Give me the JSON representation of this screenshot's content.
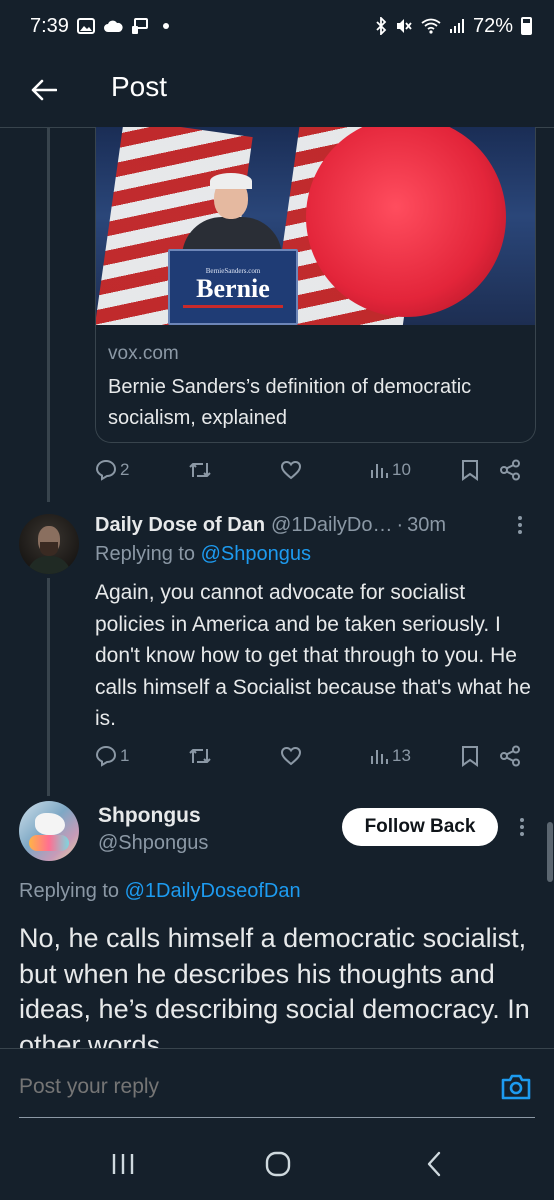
{
  "status_bar": {
    "time": "7:39",
    "battery": "72%"
  },
  "header": {
    "title": "Post"
  },
  "link_card": {
    "podium_sub": "BernieSanders.com",
    "podium_main": "Bernie",
    "domain": "vox.com",
    "title": "Bernie Sanders’s definition of democratic socialism, explained"
  },
  "original_actions": {
    "replies": "2",
    "reposts": "",
    "likes": "",
    "views": "10"
  },
  "reply_tweet": {
    "name": "Daily Dose of Dan",
    "handle": "@1DailyDo…",
    "dot": "·",
    "time": "30m",
    "replying_label": "Replying to",
    "replying_handle": "@Shpongus",
    "body": "Again, you cannot advocate for socialist policies in America and be taken seriously. I don't know how to get that through to you. He calls himself a Socialist because that's what he is.",
    "replies": "1",
    "views": "13"
  },
  "main_tweet": {
    "name": "Shpongus",
    "handle": "@Shpongus",
    "follow_label": "Follow Back",
    "replying_label": "Replying to",
    "replying_handle": "@1DailyDoseofDan",
    "body": "No, he calls himself a democratic socialist, but when he describes his thoughts and ideas, he’s describing social democracy. In other words"
  },
  "reply_bar": {
    "placeholder": "Post your reply"
  },
  "colors": {
    "background": "#15202b",
    "accent": "#1d9bf0",
    "muted": "#8b98a5",
    "divider": "#38444d"
  },
  "icons": [
    "photo-icon",
    "cloud-icon",
    "cast-icon",
    "bluetooth-icon",
    "mute-icon",
    "wifi-icon",
    "signal-icon",
    "battery-icon",
    "back-arrow-icon",
    "reply-icon",
    "repost-icon",
    "like-icon",
    "views-icon",
    "bookmark-icon",
    "share-icon",
    "more-icon",
    "camera-icon",
    "recents-icon",
    "home-icon",
    "back-nav-icon"
  ]
}
